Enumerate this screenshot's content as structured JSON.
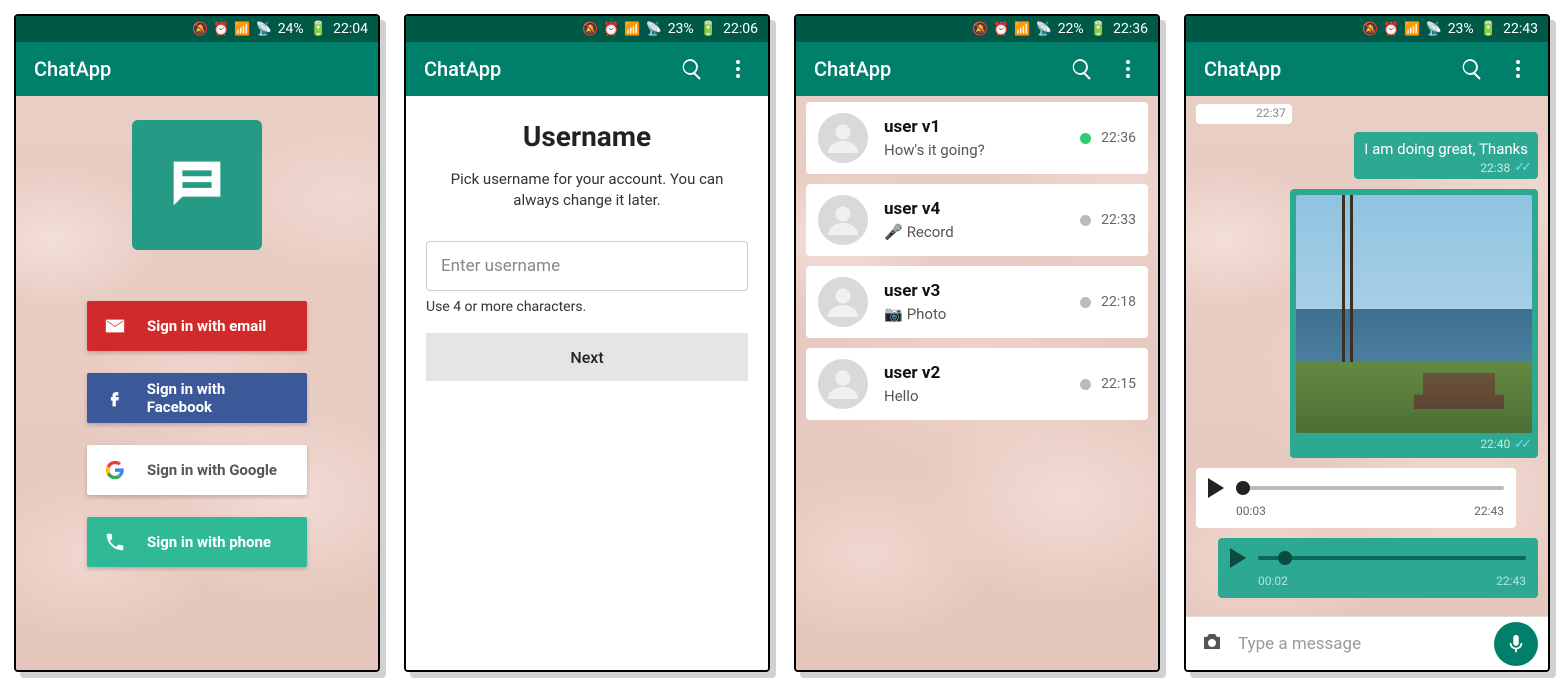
{
  "colors": {
    "teal_dark": "#005947",
    "teal": "#00806a",
    "teal_accent": "#2ca893"
  },
  "screens": {
    "login": {
      "statusbar": {
        "battery": "24%",
        "time": "22:04"
      },
      "appbar_title": "ChatApp",
      "buttons": {
        "email": "Sign in with email",
        "facebook": "Sign in with Facebook",
        "google": "Sign in with Google",
        "phone": "Sign in with phone"
      }
    },
    "username": {
      "statusbar": {
        "battery": "23%",
        "time": "22:06"
      },
      "appbar_title": "ChatApp",
      "heading": "Username",
      "subtitle": "Pick username for your account. You can always change it later.",
      "placeholder": "Enter username",
      "hint": "Use 4 or more characters.",
      "next_label": "Next"
    },
    "chatlist": {
      "statusbar": {
        "battery": "22%",
        "time": "22:36"
      },
      "appbar_title": "ChatApp",
      "chats": [
        {
          "name": "user v1",
          "preview": "How's it going?",
          "time": "22:36",
          "dot": "green",
          "icon": null
        },
        {
          "name": "user v4",
          "preview": "Record",
          "time": "22:33",
          "dot": "grey",
          "icon": "mic"
        },
        {
          "name": "user v3",
          "preview": "Photo",
          "time": "22:18",
          "dot": "grey",
          "icon": "cam"
        },
        {
          "name": "user v2",
          "preview": "Hello",
          "time": "22:15",
          "dot": "grey",
          "icon": null
        }
      ]
    },
    "conversation": {
      "statusbar": {
        "battery": "23%",
        "time": "22:43"
      },
      "appbar_title": "ChatApp",
      "stub_time": "22:37",
      "out_text": "I am doing great, Thanks",
      "out_text_time": "22:38",
      "image_time": "22:40",
      "voice_in": {
        "elapsed": "00:03",
        "time": "22:43"
      },
      "voice_out": {
        "elapsed": "00:02",
        "time": "22:43"
      },
      "composer_placeholder": "Type a message"
    }
  }
}
